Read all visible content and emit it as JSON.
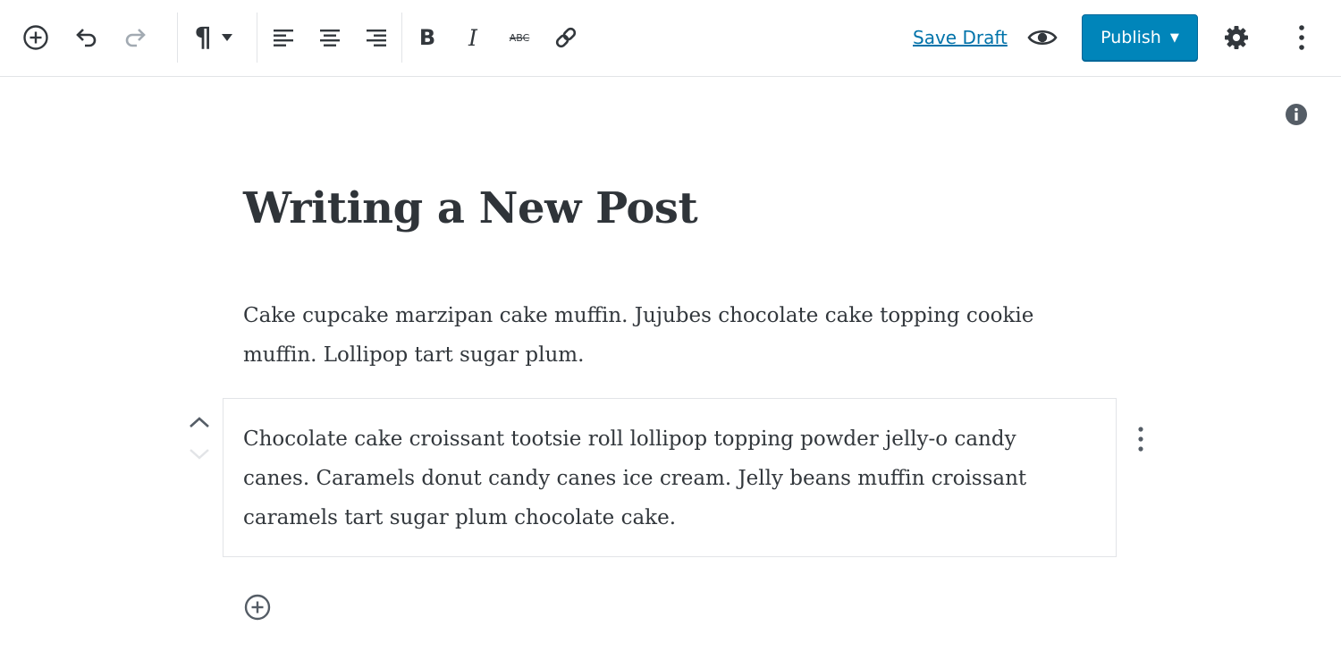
{
  "toolbar": {
    "insert_icon": "plus-circle-icon",
    "undo_icon": "undo-icon",
    "redo_icon": "redo-icon",
    "block_type_icon": "paragraph-icon",
    "block_type_glyph": "¶",
    "align_left_icon": "align-left-icon",
    "align_center_icon": "align-center-icon",
    "align_right_icon": "align-right-icon",
    "bold_glyph": "B",
    "italic_glyph": "I",
    "strikethrough_glyph": "ABC",
    "link_icon": "link-icon",
    "save_draft_label": "Save Draft",
    "preview_icon": "eye-icon",
    "publish_label": "Publish",
    "publish_caret": "▼",
    "settings_icon": "gear-icon",
    "more_icon": "more-vertical-icon"
  },
  "post": {
    "title": "Writing a New Post",
    "paragraphs": [
      "Cake cupcake marzipan cake muffin. Jujubes chocolate cake topping cookie muffin. Lollipop tart sugar plum.",
      "Chocolate cake croissant tootsie roll lollipop topping powder jelly-o candy canes. Caramels donut candy canes ice cream. Jelly beans muffin croissant caramels tart sugar plum chocolate cake."
    ]
  },
  "colors": {
    "accent": "#0085ba",
    "link": "#0073aa",
    "icon": "#555d66",
    "border": "#e2e4e7"
  }
}
